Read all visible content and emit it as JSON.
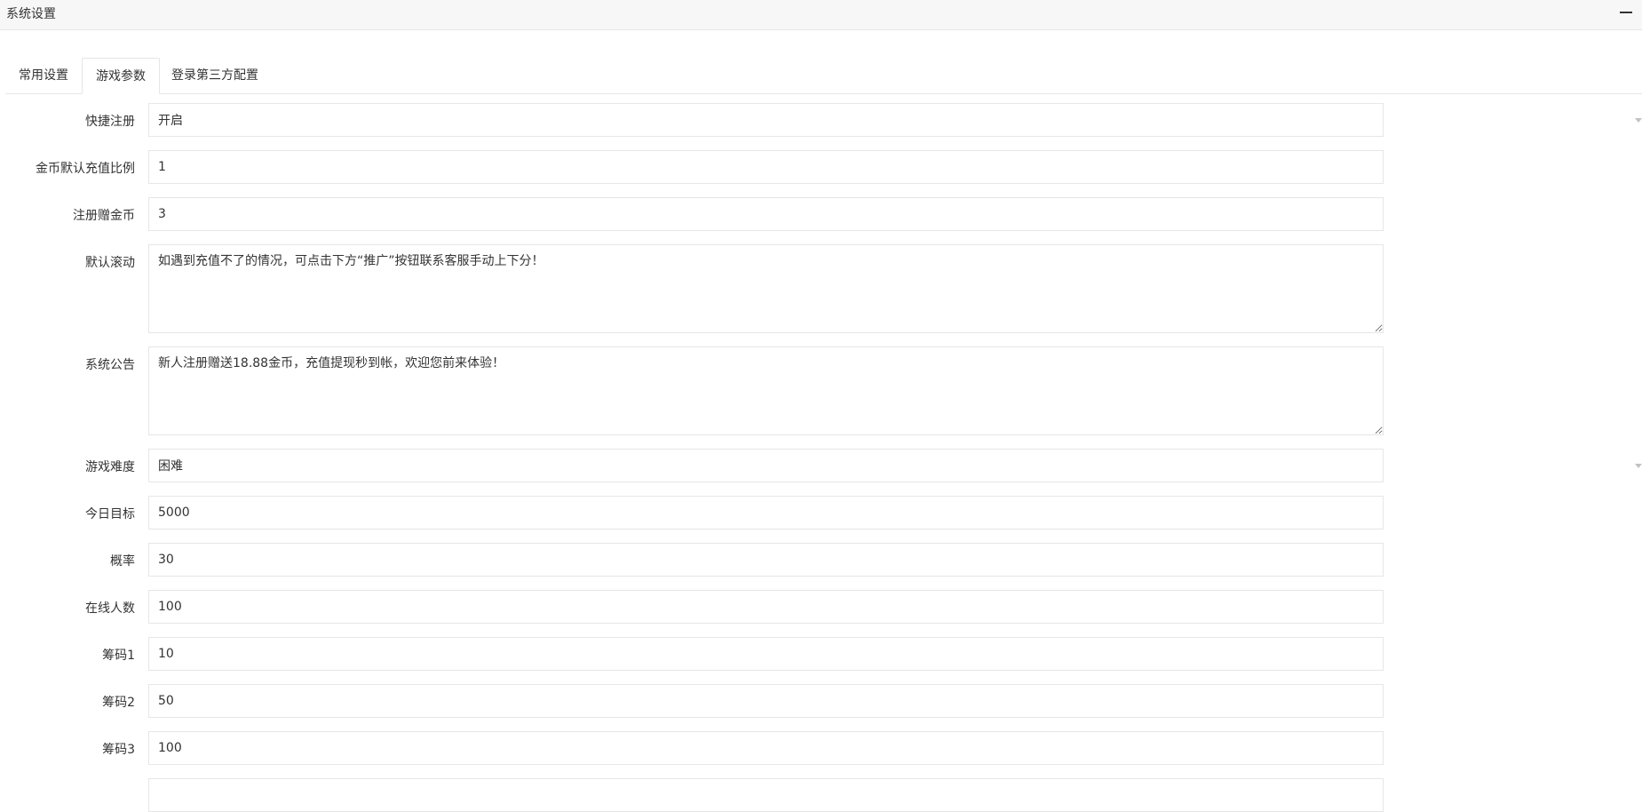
{
  "panel": {
    "title": "系统设置"
  },
  "tabs": [
    {
      "label": "常用设置"
    },
    {
      "label": "游戏参数"
    },
    {
      "label": "登录第三方配置"
    }
  ],
  "form": {
    "quick_register": {
      "label": "快捷注册",
      "value": "开启"
    },
    "coin_ratio": {
      "label": "金币默认充值比例",
      "value": "1"
    },
    "register_bonus": {
      "label": "注册赠金币",
      "value": "3"
    },
    "default_scroll": {
      "label": "默认滚动",
      "value": "如遇到充值不了的情况，可点击下方“推广”按钮联系客服手动上下分！"
    },
    "announcement": {
      "label": "系统公告",
      "value": "新人注册赠送18.88金币，充值提现秒到帐，欢迎您前来体验！"
    },
    "difficulty": {
      "label": "游戏难度",
      "value": "困难"
    },
    "daily_target": {
      "label": "今日目标",
      "value": "5000"
    },
    "probability": {
      "label": "概率",
      "value": "30"
    },
    "online_count": {
      "label": "在线人数",
      "value": "100"
    },
    "chip1": {
      "label": "筹码1",
      "value": "10"
    },
    "chip2": {
      "label": "筹码2",
      "value": "50"
    },
    "chip3": {
      "label": "筹码3",
      "value": "100"
    }
  }
}
